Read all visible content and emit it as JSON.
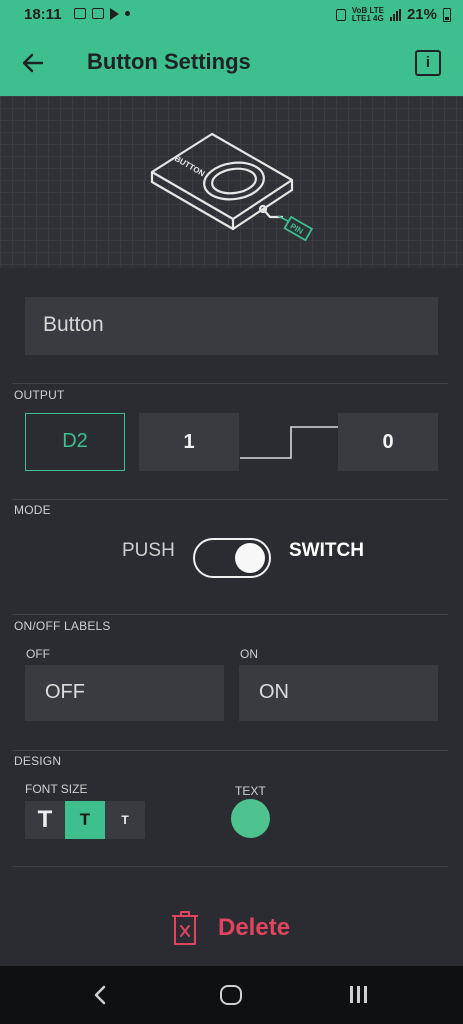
{
  "status_bar": {
    "time": "18:11",
    "network_top": "VoB LTE",
    "network_bottom": "LTE1 4G",
    "battery": "21%"
  },
  "app_bar": {
    "title": "Button Settings",
    "info_label": "i"
  },
  "illustration": {
    "device_label": "BUTTON",
    "pin_label": "PIN"
  },
  "widget_name": {
    "value": "Button"
  },
  "output": {
    "section_label": "OUTPUT",
    "pin": "D2",
    "high_value": "1",
    "low_value": "0"
  },
  "mode": {
    "section_label": "MODE",
    "left_label": "PUSH",
    "right_label": "SWITCH",
    "selected": "SWITCH"
  },
  "onoff_labels": {
    "section_label": "ON/OFF LABELS",
    "off_label": "OFF",
    "off_value": "OFF",
    "on_label": "ON",
    "on_value": "ON"
  },
  "design": {
    "section_label": "DESIGN",
    "font_size_label": "FONT SIZE",
    "font_options": [
      "T",
      "T",
      "T"
    ],
    "selected_font_index": 1,
    "text_label": "TEXT",
    "text_color": "#4ec28f"
  },
  "delete": {
    "label": "Delete"
  },
  "colors": {
    "accent": "#3dc08e",
    "danger": "#e0445f",
    "background": "#2a2c31"
  }
}
